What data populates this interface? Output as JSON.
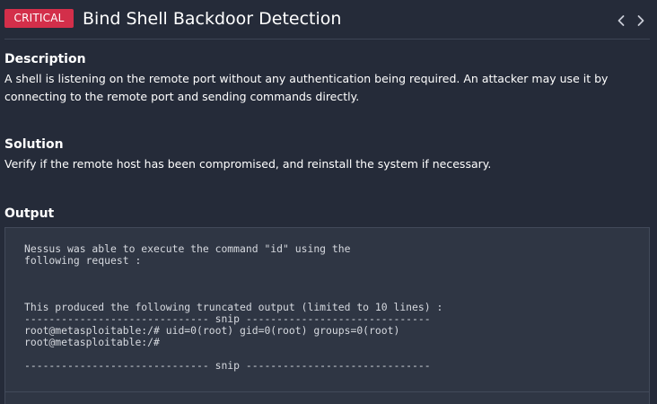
{
  "header": {
    "severity": "CRITICAL",
    "title": "Bind Shell Backdoor Detection",
    "severity_color": "#d32f4a",
    "prev_icon": "chevron-left-icon",
    "next_icon": "chevron-right-icon"
  },
  "description": {
    "heading": "Description",
    "text": "A shell is listening on the remote port without any authentication being required. An attacker may use it by connecting to the remote port and sending commands directly."
  },
  "solution": {
    "heading": "Solution",
    "text": "Verify if the remote host has been compromised, and reinstall the system if necessary."
  },
  "output": {
    "heading": "Output",
    "content": "Nessus was able to execute the command \"id\" using the\nfollowing request :\n\n\n\nThis produced the following truncated output (limited to 10 lines) :\n------------------------------ snip ------------------------------\nroot@metasploitable:/# uid=0(root) gid=0(root) groups=0(root)\nroot@metasploitable:/#\n\n------------------------------ snip ------------------------------"
  }
}
